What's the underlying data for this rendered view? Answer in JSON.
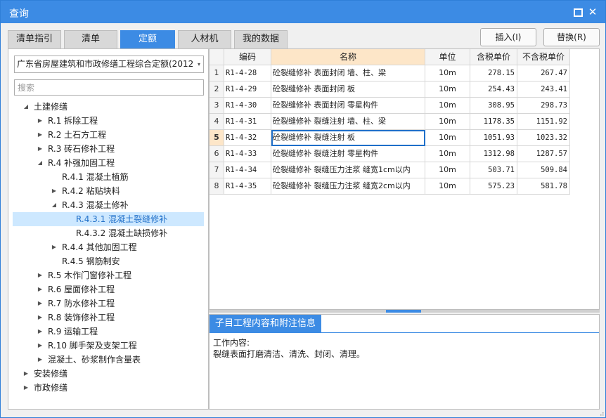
{
  "window": {
    "title": "查询"
  },
  "tabs": [
    {
      "label": "清单指引"
    },
    {
      "label": "清单"
    },
    {
      "label": "定额"
    },
    {
      "label": "人材机"
    },
    {
      "label": "我的数据"
    }
  ],
  "actions": {
    "insert": "插入(I)",
    "replace": "替换(R)"
  },
  "left": {
    "quota_book": "广东省房屋建筑和市政修缮工程综合定额(2012",
    "search_placeholder": "搜索"
  },
  "tree": [
    {
      "label": "土建修缮",
      "level": 0,
      "state": "expanded"
    },
    {
      "label": "R.1 拆除工程",
      "level": 1,
      "state": "collapsed"
    },
    {
      "label": "R.2 土石方工程",
      "level": 1,
      "state": "collapsed"
    },
    {
      "label": "R.3 砖石修补工程",
      "level": 1,
      "state": "collapsed"
    },
    {
      "label": "R.4 补强加固工程",
      "level": 1,
      "state": "expanded"
    },
    {
      "label": "R.4.1 混凝土植筋",
      "level": 2,
      "state": "leaf"
    },
    {
      "label": "R.4.2 粘贴块料",
      "level": 2,
      "state": "collapsed"
    },
    {
      "label": "R.4.3 混凝土修补",
      "level": 2,
      "state": "expanded"
    },
    {
      "label": "R.4.3.1 混凝土裂缝修补",
      "level": 3,
      "state": "leaf",
      "selected": true
    },
    {
      "label": "R.4.3.2 混凝土缺损修补",
      "level": 3,
      "state": "leaf"
    },
    {
      "label": "R.4.4 其他加固工程",
      "level": 2,
      "state": "collapsed"
    },
    {
      "label": "R.4.5 钢筋制安",
      "level": 2,
      "state": "leaf"
    },
    {
      "label": "R.5 木作门窗修补工程",
      "level": 1,
      "state": "collapsed"
    },
    {
      "label": "R.6 屋面修补工程",
      "level": 1,
      "state": "collapsed"
    },
    {
      "label": "R.7 防水修补工程",
      "level": 1,
      "state": "collapsed"
    },
    {
      "label": "R.8 装饰修补工程",
      "level": 1,
      "state": "collapsed"
    },
    {
      "label": "R.9 运输工程",
      "level": 1,
      "state": "collapsed"
    },
    {
      "label": "R.10 脚手架及支架工程",
      "level": 1,
      "state": "collapsed"
    },
    {
      "label": "混凝土、砂浆制作含量表",
      "level": 1,
      "state": "collapsed"
    },
    {
      "label": "安装修缮",
      "level": 0,
      "state": "collapsed"
    },
    {
      "label": "市政修缮",
      "level": 0,
      "state": "collapsed"
    }
  ],
  "table": {
    "headers": {
      "code": "编码",
      "name": "名称",
      "unit": "单位",
      "price_tax": "含税单价",
      "price_notax": "不含税单价"
    },
    "current_row": 5,
    "rows": [
      {
        "no": "1",
        "code": "R1-4-28",
        "name": "砼裂缝修补 表面封闭 墙、柱、梁",
        "unit": "10m",
        "price_tax": "278.15",
        "price_notax": "267.47"
      },
      {
        "no": "2",
        "code": "R1-4-29",
        "name": "砼裂缝修补 表面封闭 板",
        "unit": "10m",
        "price_tax": "254.43",
        "price_notax": "243.41"
      },
      {
        "no": "3",
        "code": "R1-4-30",
        "name": "砼裂缝修补 表面封闭 零星构件",
        "unit": "10m",
        "price_tax": "308.95",
        "price_notax": "298.73"
      },
      {
        "no": "4",
        "code": "R1-4-31",
        "name": "砼裂缝修补 裂缝注射 墙、柱、梁",
        "unit": "10m",
        "price_tax": "1178.35",
        "price_notax": "1151.92"
      },
      {
        "no": "5",
        "code": "R1-4-32",
        "name": "砼裂缝修补 裂缝注射 板",
        "unit": "10m",
        "price_tax": "1051.93",
        "price_notax": "1023.32"
      },
      {
        "no": "6",
        "code": "R1-4-33",
        "name": "砼裂缝修补 裂缝注射 零星构件",
        "unit": "10m",
        "price_tax": "1312.98",
        "price_notax": "1287.57"
      },
      {
        "no": "7",
        "code": "R1-4-34",
        "name": "砼裂缝修补 裂缝压力注浆 缝宽1cm以内",
        "unit": "10m",
        "price_tax": "503.71",
        "price_notax": "509.84"
      },
      {
        "no": "8",
        "code": "R1-4-35",
        "name": "砼裂缝修补 裂缝压力注浆 缝宽2cm以内",
        "unit": "10m",
        "price_tax": "575.23",
        "price_notax": "581.78"
      }
    ]
  },
  "detail": {
    "tab": "子目工程内容和附注信息",
    "heading": "工作内容:",
    "text": "裂缝表面打磨清洁、清洗、封闭、清理。"
  },
  "icons": {
    "maximize": "maximize-icon",
    "close": "close-icon",
    "dropdown": "▾",
    "expanded": "◢",
    "collapsed": "▶"
  },
  "colors": {
    "accent": "#3c8be4",
    "selection": "#cde8ff",
    "header_highlight": "#fde6c8"
  }
}
